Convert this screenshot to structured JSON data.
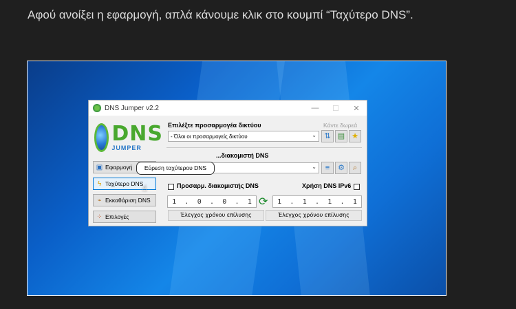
{
  "article": {
    "text": "Αφού ανοίξει η εφαρμογή, απλά κάνουμε κλικ στο κουμπί “Ταχύτερο DNS”."
  },
  "window": {
    "title": "DNS Jumper v2.2",
    "minimize": "—",
    "maximize": "☐",
    "close": "✕"
  },
  "logo": {
    "dns": "DNS",
    "jumper": "JUMPER"
  },
  "left_buttons": [
    {
      "label": "Εφαρμογή",
      "icon": "save-icon"
    },
    {
      "label": "Ταχύτερο DNS",
      "icon": "lightning-icon"
    },
    {
      "label": "Εκκαθάριση DNS",
      "icon": "broom-icon"
    },
    {
      "label": "Επιλογές",
      "icon": "options-icon"
    }
  ],
  "adapter": {
    "label": "Επιλέξτε προσαρμογέα δικτύου",
    "donate": "Κάντε δωρεά",
    "value": "- Όλοι οι προσαρμογείς δικτύου"
  },
  "server": {
    "label": "...διακομιστή DNS"
  },
  "custom_dns": {
    "label": "Προσαρμ. διακομιστής DNS",
    "ipv6_label": "Χρήση DNS IPv6"
  },
  "ip1": [
    "1",
    ".",
    "0",
    ".",
    "0",
    ".",
    "1"
  ],
  "ip2": [
    "1",
    ".",
    "1",
    ".",
    "1",
    ".",
    "1"
  ],
  "resolve_label": "Έλεγχος χρόνου επίλυσης",
  "tooltip": "Εύρεση ταχύτερου DNS"
}
